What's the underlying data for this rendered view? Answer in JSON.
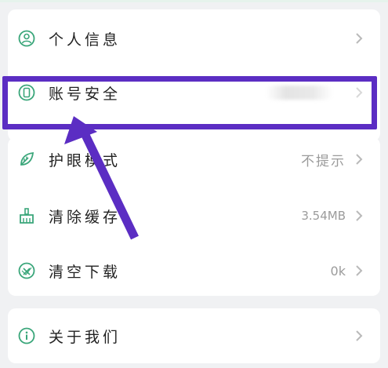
{
  "settings": {
    "items": [
      {
        "label": "个人信息",
        "icon": "user-circle-icon",
        "value": ""
      },
      {
        "label": "账号安全",
        "icon": "phone-icon",
        "value": ""
      },
      {
        "label": "护眼模式",
        "icon": "leaf-icon",
        "value": "不提示"
      },
      {
        "label": "清除缓存",
        "icon": "broom-icon",
        "value": "3.54MB"
      },
      {
        "label": "清空下载",
        "icon": "download-clear-icon",
        "value": "0k"
      },
      {
        "label": "关于我们",
        "icon": "info-icon",
        "value": ""
      }
    ]
  },
  "colors": {
    "accent": "#3aa67a",
    "annotation": "#5b2dc3",
    "chevron": "#b9b9b9"
  }
}
